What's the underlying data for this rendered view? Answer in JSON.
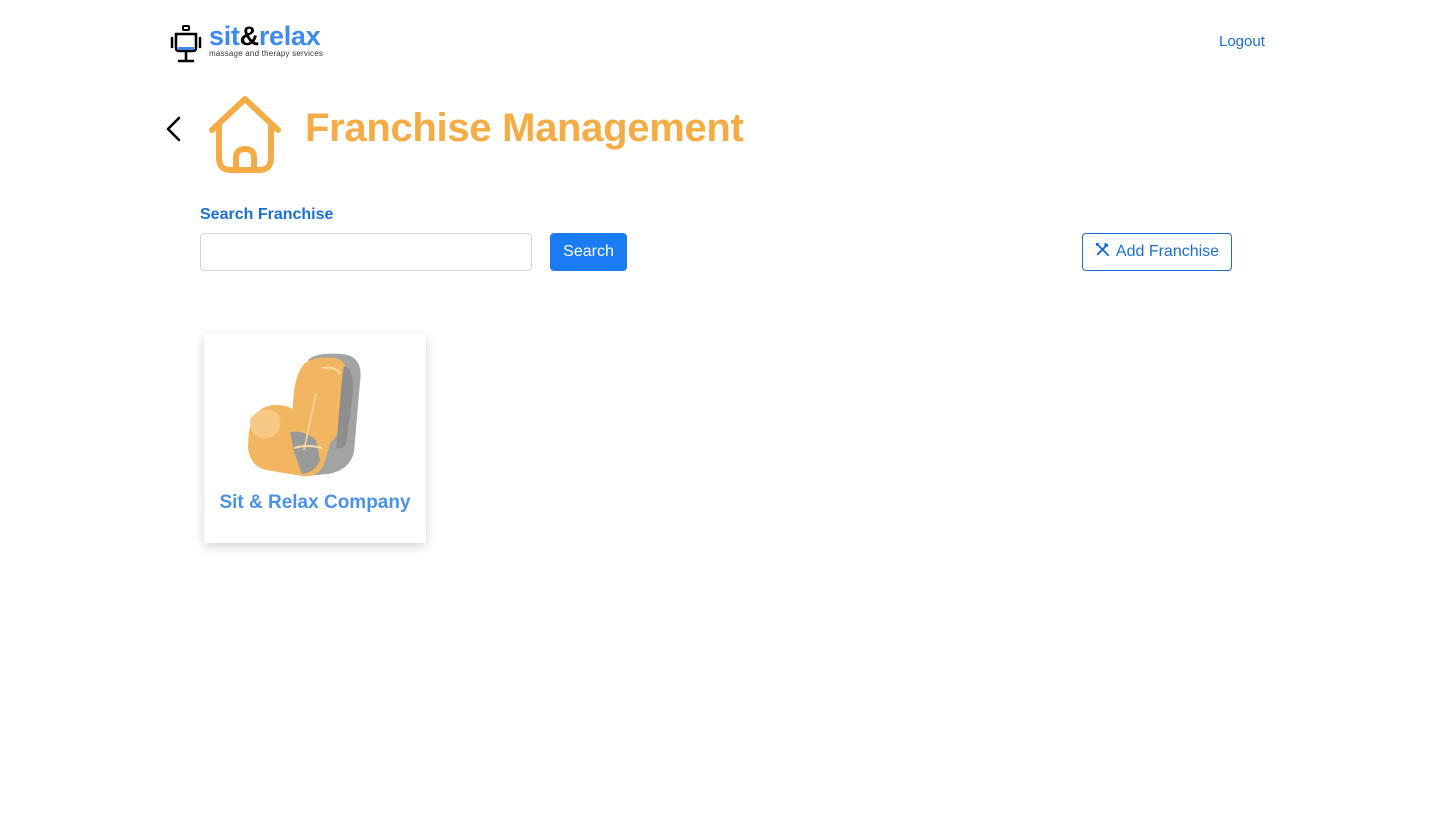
{
  "header": {
    "logo": {
      "brand_main": "sit",
      "brand_amp": "&",
      "brand_tail": "relax",
      "tagline": "massage and therapy services"
    },
    "logout_label": "Logout"
  },
  "title": {
    "text": "Franchise Management",
    "icon": "house-icon",
    "back_icon": "chevron-left-icon"
  },
  "search": {
    "label": "Search Franchise",
    "value": "",
    "placeholder": "",
    "button_label": "Search"
  },
  "add_button": {
    "label": "Add Franchise",
    "icon": "tools-icon"
  },
  "franchises": [
    {
      "name": "Sit & Relax Company",
      "image": "massage-chair-image"
    }
  ],
  "colors": {
    "brand_blue": "#3d8af0",
    "link_blue": "#1a6fd6",
    "primary_button": "#1a7bf2",
    "title_orange": "#f5ac44"
  }
}
